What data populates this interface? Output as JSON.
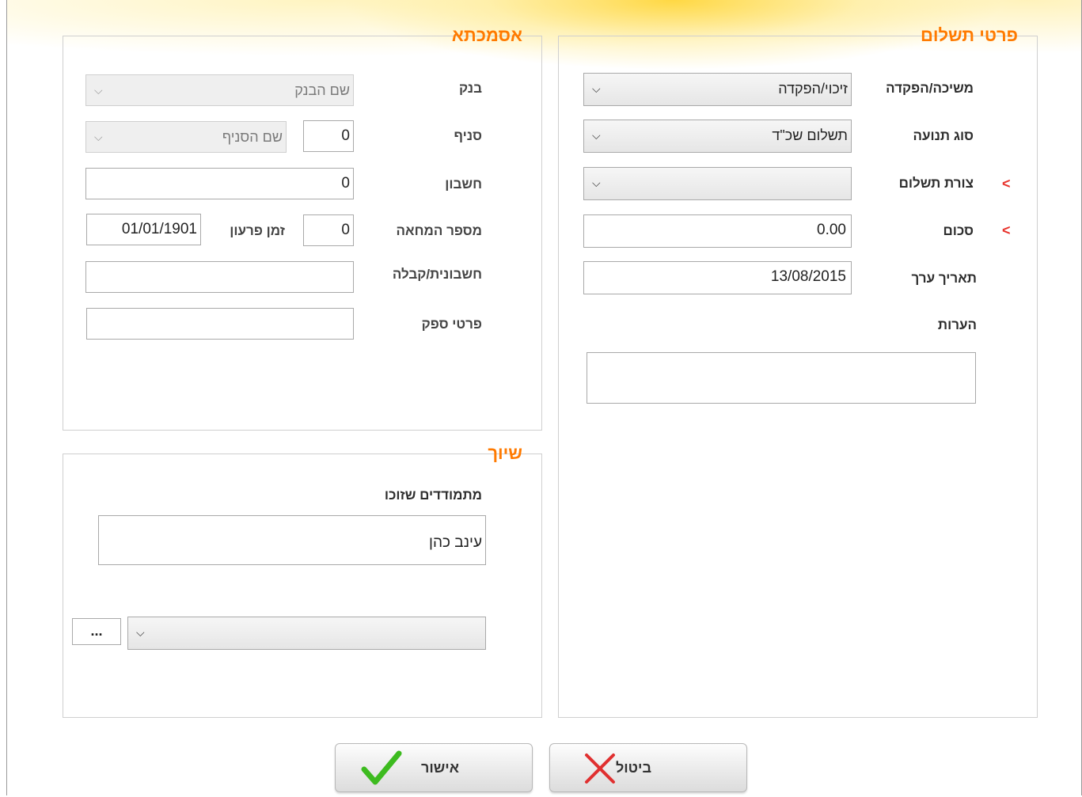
{
  "payment_details": {
    "legend": "פרטי תשלום",
    "withdrawal_deposit": {
      "label": "משיכה/הפקדה",
      "value": "זיכוי/הפקדה"
    },
    "transaction_type": {
      "label": "סוג תנועה",
      "value": "תשלום שכ\"ד"
    },
    "payment_method": {
      "label": "צורת תשלום",
      "value": "",
      "required_mark": "<"
    },
    "amount": {
      "label": "סכום",
      "value": "0.00",
      "required_mark": "<"
    },
    "value_date": {
      "label": "תאריך ערך",
      "value": "13/08/2015"
    },
    "notes": {
      "label": "הערות",
      "value": ""
    }
  },
  "reference": {
    "legend": "אסמכתא",
    "bank": {
      "label": "בנק",
      "placeholder": "שם הבנק"
    },
    "branch": {
      "label": "סניף",
      "number": "0",
      "placeholder": "שם הסניף"
    },
    "account": {
      "label": "חשבון",
      "value": "0"
    },
    "check_number": {
      "label": "מספר המחאה",
      "value": "0"
    },
    "due_date": {
      "label": "זמן פרעון",
      "value": "01/01/1901"
    },
    "invoice_receipt": {
      "label": "חשבונית/קבלה",
      "value": ""
    },
    "supplier_details": {
      "label": "פרטי ספק",
      "value": ""
    }
  },
  "assignment": {
    "legend": "שיוך",
    "winners_label": "מתמודדים שזוכו",
    "winners_value": "עינב כהן",
    "select_value": "",
    "more_button": "..."
  },
  "buttons": {
    "confirm": "אישור",
    "cancel": "ביטול"
  },
  "colors": {
    "accent": "#ff7a00",
    "required": "#e8322b",
    "check": "#3dbb1f",
    "cross": "#e03030"
  }
}
